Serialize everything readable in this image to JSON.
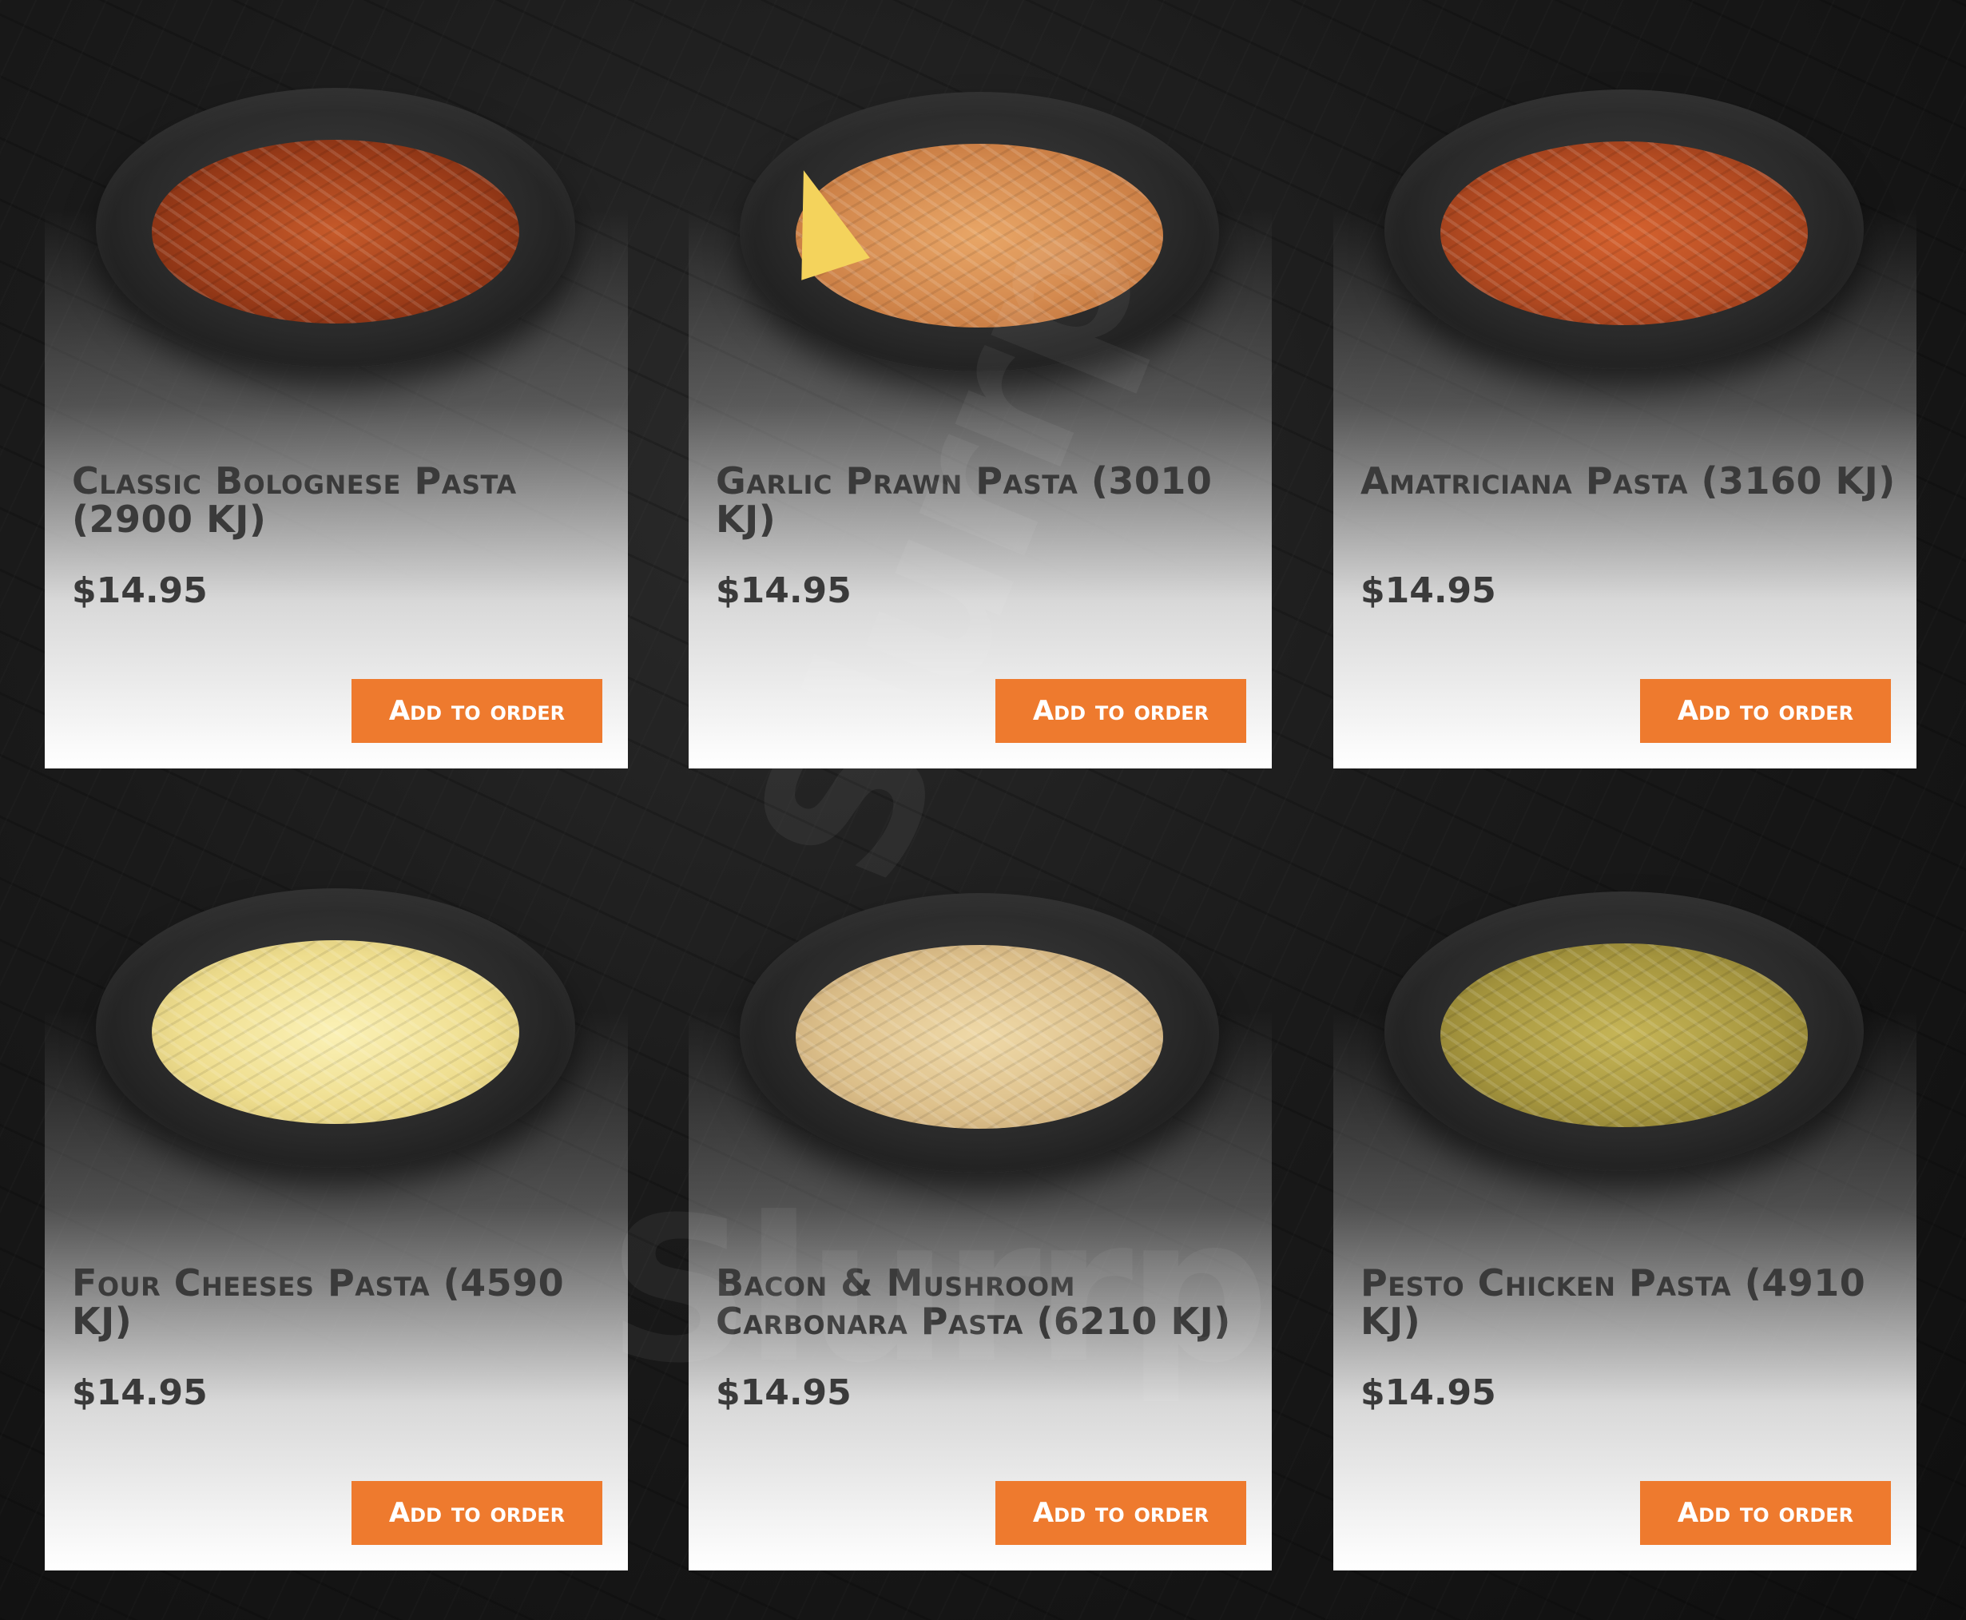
{
  "colors": {
    "accent": "#ee7a2e",
    "text": "#3a3a3a",
    "background": "#1a1a1a"
  },
  "watermark": "Slurrp",
  "items": [
    {
      "name": "Classic Bolognese Pasta (2900 KJ)",
      "price": "$14.95",
      "button": "Add to order",
      "image": "bolognese-pasta-image"
    },
    {
      "name": "Garlic Prawn Pasta (3010 KJ)",
      "price": "$14.95",
      "button": "Add to order",
      "image": "garlic-prawn-pasta-image"
    },
    {
      "name": "Amatriciana Pasta (3160 KJ)",
      "price": "$14.95",
      "button": "Add to order",
      "image": "amatriciana-pasta-image"
    },
    {
      "name": "Four Cheeses Pasta (4590 KJ)",
      "price": "$14.95",
      "button": "Add to order",
      "image": "four-cheeses-pasta-image"
    },
    {
      "name": "Bacon & Mushroom Carbonara Pasta (6210 KJ)",
      "price": "$14.95",
      "button": "Add to order",
      "image": "carbonara-pasta-image"
    },
    {
      "name": "Pesto Chicken Pasta (4910 KJ)",
      "price": "$14.95",
      "button": "Add to order",
      "image": "pesto-chicken-pasta-image"
    }
  ]
}
